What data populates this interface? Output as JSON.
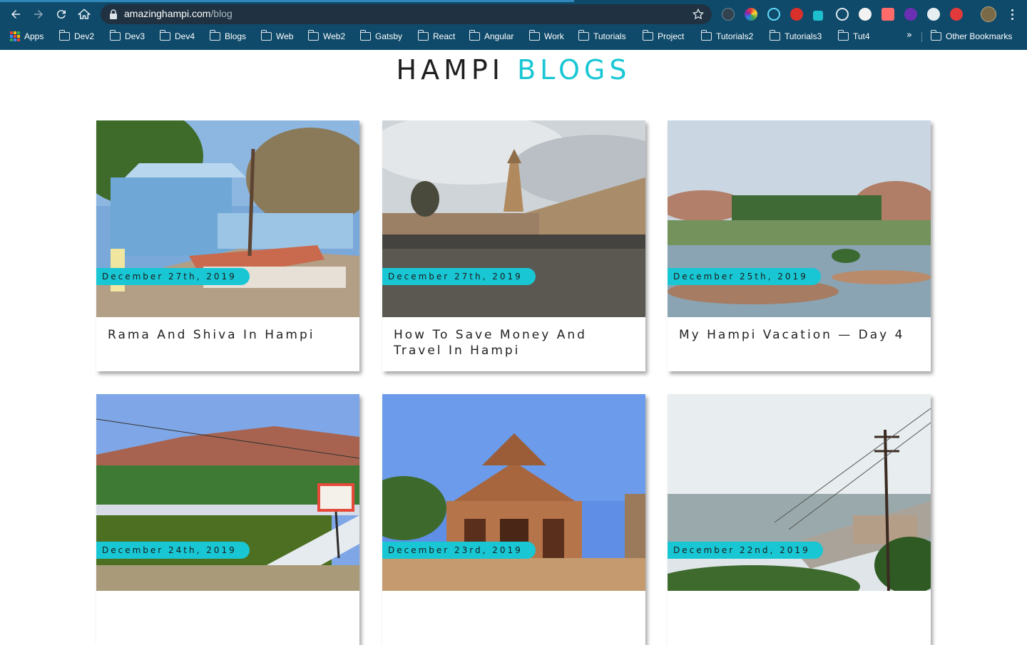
{
  "browser": {
    "url_host": "amazinghampi.com",
    "url_path": "/blog",
    "bookmarks": [
      "Apps",
      "Dev2",
      "Dev3",
      "Dev4",
      "Blogs",
      "Web",
      "Web2",
      "Gatsby",
      "React",
      "Angular",
      "Work",
      "Tutorials",
      "Project",
      "Tutorials2",
      "Tutorials3",
      "Tut4"
    ],
    "overflow_label": "»",
    "other_bookmarks": "Other Bookmarks"
  },
  "header": {
    "title_main": "HAMPI",
    "title_accent": "BLOGS",
    "accent_color": "#19c7d4"
  },
  "posts": [
    {
      "date": "December 27th, 2019",
      "title": "Rama And Shiva In Hampi"
    },
    {
      "date": "December 27th, 2019",
      "title": "How To Save Money And Travel In Hampi"
    },
    {
      "date": "December 25th, 2019",
      "title": "My Hampi Vacation — Day 4"
    },
    {
      "date": "December 24th, 2019",
      "title": ""
    },
    {
      "date": "December 23rd, 2019",
      "title": ""
    },
    {
      "date": "December 22nd, 2019",
      "title": ""
    }
  ]
}
